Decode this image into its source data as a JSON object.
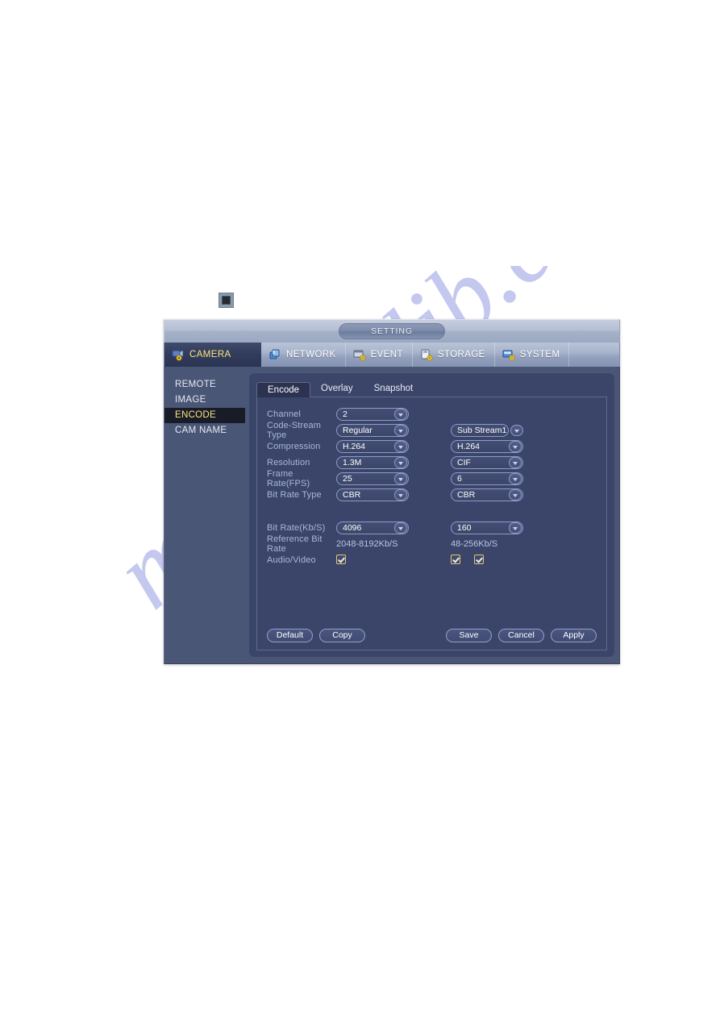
{
  "dialog": {
    "title": "SETTING",
    "nav": [
      {
        "label": "CAMERA",
        "icon": "camera-gear-icon",
        "active": true
      },
      {
        "label": "NETWORK",
        "icon": "network-gear-icon",
        "active": false
      },
      {
        "label": "EVENT",
        "icon": "event-gear-icon",
        "active": false
      },
      {
        "label": "STORAGE",
        "icon": "storage-gear-icon",
        "active": false
      },
      {
        "label": "SYSTEM",
        "icon": "system-gear-icon",
        "active": false
      }
    ],
    "sidebar": [
      {
        "label": "REMOTE",
        "active": false
      },
      {
        "label": "IMAGE",
        "active": false
      },
      {
        "label": "ENCODE",
        "active": true
      },
      {
        "label": "CAM NAME",
        "active": false
      }
    ],
    "tabs": [
      {
        "label": "Encode",
        "active": true
      },
      {
        "label": "Overlay",
        "active": false
      },
      {
        "label": "Snapshot",
        "active": false
      }
    ],
    "form": {
      "channel": {
        "label": "Channel",
        "value": "2"
      },
      "code_stream_type": {
        "label": "Code-Stream Type",
        "main": "Regular",
        "sub": "Sub Stream1"
      },
      "compression": {
        "label": "Compression",
        "main": "H.264",
        "sub": "H.264"
      },
      "resolution": {
        "label": "Resolution",
        "main": "1.3M",
        "sub": "CIF"
      },
      "frame_rate": {
        "label": "Frame Rate(FPS)",
        "main": "25",
        "sub": "6"
      },
      "bit_rate_type": {
        "label": "Bit Rate Type",
        "main": "CBR",
        "sub": "CBR"
      },
      "bit_rate": {
        "label": "Bit Rate(Kb/S)",
        "main": "4096",
        "sub": "160"
      },
      "reference_bit_rate": {
        "label": "Reference Bit Rate",
        "main": "2048-8192Kb/S",
        "sub": "48-256Kb/S"
      },
      "audio_video": {
        "label": "Audio/Video",
        "main_checked": true,
        "sub_checked_1": true,
        "sub_checked_2": true
      }
    },
    "buttons": {
      "default": "Default",
      "copy": "Copy",
      "save": "Save",
      "cancel": "Cancel",
      "apply": "Apply"
    }
  },
  "watermark": {
    "text": "manualslib.com",
    "color": "#3f49c8"
  },
  "colors": {
    "accent_yellow": "#ffe37a",
    "panel_blue": "#3b456a",
    "dialog_blue": "#4a5676",
    "titlebar_light": "#b7c1d4",
    "label_blue": "#a9b6dd"
  }
}
